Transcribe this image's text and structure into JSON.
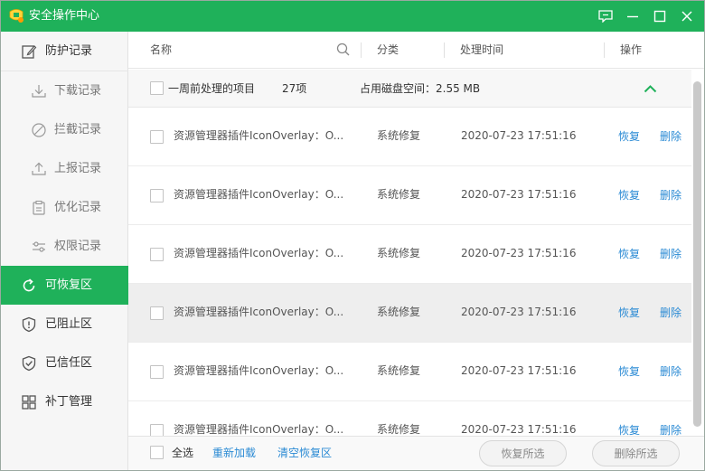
{
  "window": {
    "title": "安全操作中心",
    "accent_color": "#1fb15a",
    "controls": [
      "feedback-icon",
      "minimize-icon",
      "maximize-icon",
      "close-icon"
    ]
  },
  "sidebar": {
    "items": [
      {
        "label": "防护记录",
        "icon": "edit-icon",
        "level": "top",
        "active": false
      },
      {
        "label": "下载记录",
        "icon": "download-icon",
        "level": "sub",
        "active": false
      },
      {
        "label": "拦截记录",
        "icon": "block-icon",
        "level": "sub",
        "active": false
      },
      {
        "label": "上报记录",
        "icon": "upload-icon",
        "level": "sub",
        "active": false
      },
      {
        "label": "优化记录",
        "icon": "clipboard-icon",
        "level": "sub",
        "active": false
      },
      {
        "label": "权限记录",
        "icon": "sliders-icon",
        "level": "sub",
        "active": false
      },
      {
        "label": "可恢复区",
        "icon": "restore-icon",
        "level": "top",
        "active": true
      },
      {
        "label": "已阻止区",
        "icon": "shield-alert-icon",
        "level": "top",
        "active": false
      },
      {
        "label": "已信任区",
        "icon": "shield-check-icon",
        "level": "top",
        "active": false
      },
      {
        "label": "补丁管理",
        "icon": "patch-grid-icon",
        "level": "top",
        "active": false
      }
    ]
  },
  "table": {
    "headers": {
      "name": "名称",
      "category": "分类",
      "time": "处理时间",
      "action": "操作"
    },
    "group": {
      "label": "一周前处理的项目",
      "count": "27项",
      "disk_usage": "占用磁盘空间：2.55 MB",
      "expanded": true
    },
    "rows": [
      {
        "name": "资源管理器插件IconOverlay：O...",
        "category": "系统修复",
        "time": "2020-07-23 17:51:16",
        "restore": "恢复",
        "delete": "删除"
      },
      {
        "name": "资源管理器插件IconOverlay：O...",
        "category": "系统修复",
        "time": "2020-07-23 17:51:16",
        "restore": "恢复",
        "delete": "删除"
      },
      {
        "name": "资源管理器插件IconOverlay：O...",
        "category": "系统修复",
        "time": "2020-07-23 17:51:16",
        "restore": "恢复",
        "delete": "删除"
      },
      {
        "name": "资源管理器插件IconOverlay：O...",
        "category": "系统修复",
        "time": "2020-07-23 17:51:16",
        "restore": "恢复",
        "delete": "删除"
      },
      {
        "name": "资源管理器插件IconOverlay：O...",
        "category": "系统修复",
        "time": "2020-07-23 17:51:16",
        "restore": "恢复",
        "delete": "删除"
      },
      {
        "name": "资源管理器插件IconOverlay：O...",
        "category": "系统修复",
        "time": "2020-07-23 17:51:16",
        "restore": "恢复",
        "delete": "删除"
      }
    ]
  },
  "footer": {
    "select_all": "全选",
    "reload": "重新加载",
    "clear": "清空恢复区",
    "restore_selected": "恢复所选",
    "delete_selected": "删除所选"
  }
}
